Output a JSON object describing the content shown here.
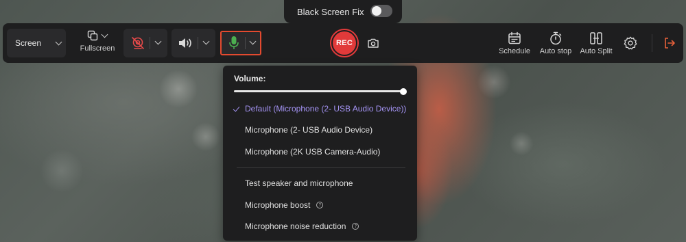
{
  "black_screen_fix": {
    "label": "Black Screen Fix",
    "enabled": false
  },
  "toolbar": {
    "capture_mode": "Screen",
    "fullscreen_label": "Fullscreen",
    "webcam_icon": "webcam-off-icon",
    "speaker_icon": "speaker-icon",
    "mic_icon": "microphone-icon",
    "rec_label": "REC",
    "screenshot_icon": "camera-icon",
    "schedule_label": "Schedule",
    "auto_stop_label": "Auto stop",
    "auto_split_label": "Auto Split",
    "settings_icon": "gear-icon",
    "exit_icon": "exit-icon"
  },
  "mic_dropdown": {
    "volume_label": "Volume:",
    "volume_level": 1.0,
    "devices": [
      "Default (Microphone (2- USB Audio Device))",
      "Microphone (2- USB Audio Device)",
      "Microphone (2K USB Camera-Audio)"
    ],
    "selected_device_index": 0,
    "actions": {
      "test": "Test speaker and microphone",
      "boost": "Microphone boost",
      "noise_reduction": "Microphone noise reduction"
    }
  },
  "colors": {
    "accent": "#a594f5",
    "rec": "#e13a3a",
    "mic_active": "#4caf50",
    "webcam_off": "#e84a4a",
    "exit": "#e8613a",
    "highlight": "#e34a2f"
  }
}
